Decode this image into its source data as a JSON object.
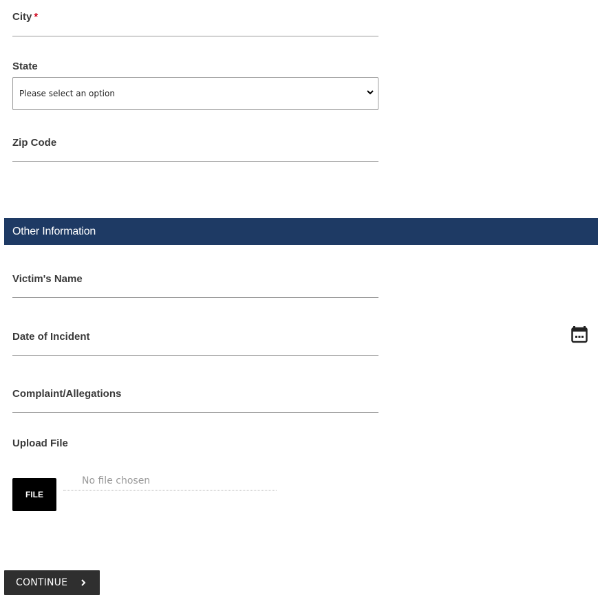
{
  "address": {
    "city_label": "City",
    "city_required_mark": "*",
    "state_label": "State",
    "state_selected": "Please select an option",
    "zip_label": "Zip Code"
  },
  "other_information": {
    "section_title": "Other Information",
    "victim_name_label": "Victim's Name",
    "date_of_incident_label": "Date of Incident",
    "complaint_label": "Complaint/Allegations",
    "upload_label": "Upload File",
    "file_button_label": "FILE",
    "file_status": "No file chosen"
  },
  "actions": {
    "continue_label": "CONTINUE"
  },
  "colors": {
    "section_header_bg": "#1e3a64",
    "required_mark": "#d0021b",
    "continue_button_bg": "#2f2f2f"
  },
  "icons": {
    "state_dropdown": "chevron-down-icon",
    "date_picker": "calendar-icon",
    "continue": "chevron-right-icon"
  }
}
